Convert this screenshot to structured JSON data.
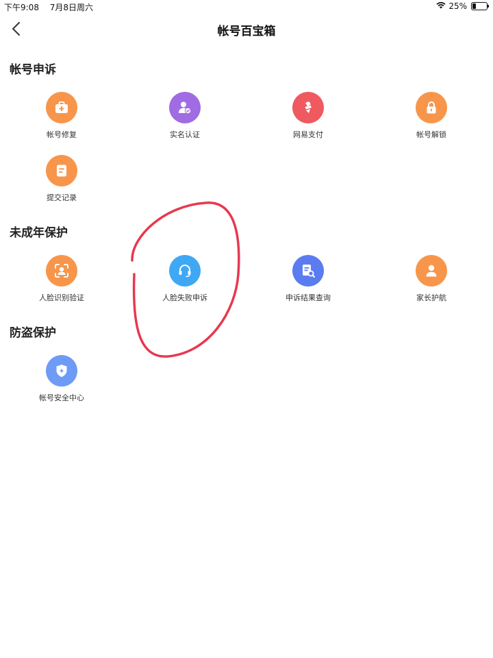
{
  "status_bar": {
    "time": "下午9:08",
    "date": "7月8日周六",
    "battery": "25%",
    "battery_level": 0.25
  },
  "header": {
    "title": "帐号百宝箱"
  },
  "sections": [
    {
      "title": "帐号申诉",
      "items": [
        {
          "label": "帐号修复",
          "icon": "medical-case-icon",
          "color": "#F7964B"
        },
        {
          "label": "实名认证",
          "icon": "user-verified-icon",
          "color": "#A06BE3"
        },
        {
          "label": "网易支付",
          "icon": "netease-pay-icon",
          "color": "#EE5A5F"
        },
        {
          "label": "帐号解锁",
          "icon": "unlock-icon",
          "color": "#F7964B"
        },
        {
          "label": "提交记录",
          "icon": "document-icon",
          "color": "#F7964B"
        }
      ]
    },
    {
      "title": "未成年保护",
      "items": [
        {
          "label": "人脸识别验证",
          "icon": "face-scan-icon",
          "color": "#F7964B"
        },
        {
          "label": "人脸失败申诉",
          "icon": "headset-icon",
          "color": "#3FA8F4"
        },
        {
          "label": "申诉结果查询",
          "icon": "document-search-icon",
          "color": "#5B7CF0"
        },
        {
          "label": "家长护航",
          "icon": "parent-user-icon",
          "color": "#F7964B"
        }
      ]
    },
    {
      "title": "防盗保护",
      "items": [
        {
          "label": "帐号安全中心",
          "icon": "shield-icon",
          "color": "#6E9BF5"
        }
      ]
    }
  ],
  "annotation": {
    "color": "#E8384F"
  }
}
